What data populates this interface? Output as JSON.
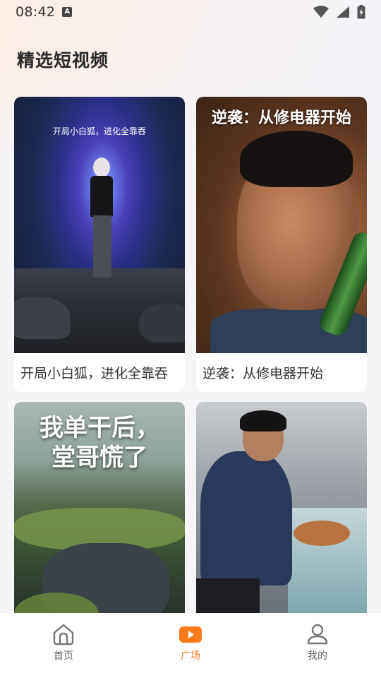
{
  "status_bar": {
    "time": "08:42",
    "notification_icon": "text-notification-icon",
    "icons": [
      "wifi-icon",
      "cellular-signal-icon",
      "battery-charging-icon"
    ]
  },
  "page": {
    "title": "精选短视频"
  },
  "videos": [
    {
      "title": "开局小白狐，进化全靠吞",
      "thumbnail_text": "开局小白狐，进化全靠吞"
    },
    {
      "title": "逆袭：从修电器开始",
      "thumbnail_text": "逆袭：从修电器开始"
    },
    {
      "title": "",
      "thumbnail_text_line1": "我单干后，",
      "thumbnail_text_line2": "堂哥慌了"
    },
    {
      "title": "",
      "thumbnail_text": ""
    }
  ],
  "bottom_nav": {
    "items": [
      {
        "label": "首页",
        "icon": "home-icon",
        "active": false
      },
      {
        "label": "广场",
        "icon": "video-play-icon",
        "active": true
      },
      {
        "label": "我的",
        "icon": "user-profile-icon",
        "active": false
      }
    ],
    "active_color": "#ff7a1a",
    "inactive_color": "#666666"
  }
}
